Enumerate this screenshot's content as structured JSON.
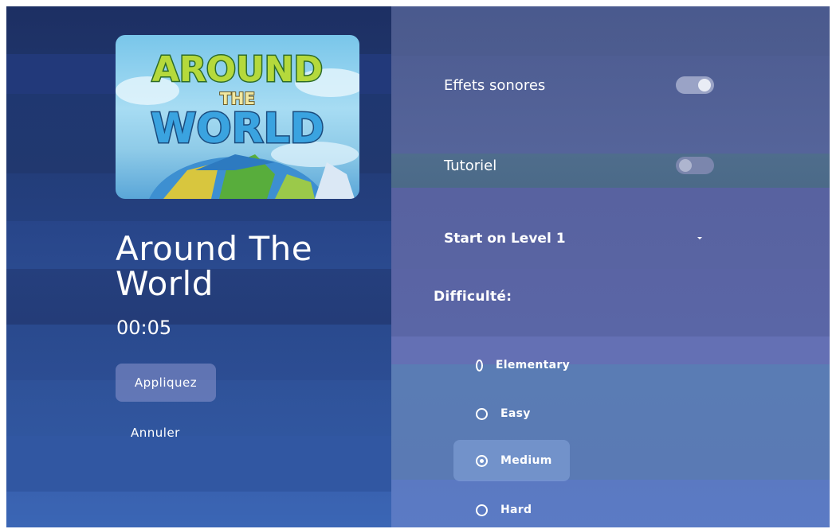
{
  "game": {
    "image_name": "around-the-world-cover",
    "image_text": [
      "AROUND",
      "THE",
      "WORLD"
    ],
    "title": "Around The World",
    "time": "00:05"
  },
  "actions": {
    "apply_label": "Appliquez",
    "cancel_label": "Annuler"
  },
  "settings": {
    "sound_effects": {
      "label": "Effets sonores",
      "enabled": true
    },
    "tutorial": {
      "label": "Tutoriel",
      "enabled": false
    },
    "start_level": {
      "label": "Start on Level 1",
      "icon": "dropdown-arrow-icon"
    }
  },
  "difficulty": {
    "label": "Difficulté:",
    "options": [
      {
        "label": "Elementary",
        "selected": false
      },
      {
        "label": "Easy",
        "selected": false
      },
      {
        "label": "Medium",
        "selected": true
      },
      {
        "label": "Hard",
        "selected": false
      }
    ]
  },
  "colors": {
    "left_panel": "#22397a",
    "right_panel": "#55649a",
    "text": "#ffffff"
  }
}
